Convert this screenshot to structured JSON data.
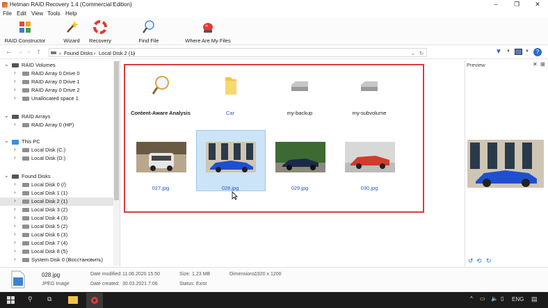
{
  "window": {
    "title": "Hetman RAID Recovery 1.4 (Commercial Edition)",
    "minimize": "–",
    "maximize": "❐",
    "close": "✕"
  },
  "menu": [
    "File",
    "Edit",
    "View",
    "Tools",
    "Help"
  ],
  "toolbar": {
    "raid_constructor": "RAID Constructor",
    "wizard": "Wizard",
    "recovery": "Recovery",
    "find_file": "Find File",
    "where_are_my_files": "Where Are My Files"
  },
  "address": {
    "segments": [
      "Found Disks",
      "Local Disk 2 (1)"
    ]
  },
  "tree": {
    "raid_volumes": {
      "label": "RAID Volumes",
      "items": [
        "RAID Array 0 Drive 0",
        "RAID Array 0 Drive 1",
        "RAID Array 0 Drive 2",
        "Unallocated space 1"
      ]
    },
    "raid_arrays": {
      "label": "RAID Arrays",
      "items": [
        "RAID Array 0 (HP)"
      ]
    },
    "this_pc": {
      "label": "This PC",
      "items": [
        "Local Disk (C:)",
        "Local Disk (D:)"
      ]
    },
    "found_disks": {
      "label": "Found Disks",
      "items": [
        "Local Disk 0 (/)",
        "Local Disk 1 (1)",
        "Local Disk 2 (1)",
        "Local Disk 3 (2)",
        "Local Disk 4 (3)",
        "Local Disk 5 (2)",
        "Local Disk 6 (3)",
        "Local Disk 7 (4)",
        "Local Disk 8 (5)",
        "System Disk 0 (Восстановить)"
      ],
      "selected_index": 2
    }
  },
  "content": {
    "folders": [
      "Content-Aware Analysis",
      "Car",
      "my-backup",
      "my-subvolume"
    ],
    "files": [
      "027.jpg",
      "028.jpg",
      "029.jpg",
      "030.jpg"
    ],
    "selected_file": "028.jpg"
  },
  "preview": {
    "title": "Preview"
  },
  "status": {
    "filename": "028.jpg",
    "filetype": "JPEG Image",
    "date_modified_label": "Date modified:",
    "date_modified": "11.06.2020 15:50",
    "date_created_label": "Date created:",
    "date_created": "30.03.2021 7:06",
    "size_label": "Size:",
    "size": "1,23 MB",
    "status_label": "Status:",
    "status": "Exist",
    "dimensions_label": "Dimensions:",
    "dimensions": "1920 x 1200"
  },
  "taskbar": {
    "lang": "ENG"
  }
}
